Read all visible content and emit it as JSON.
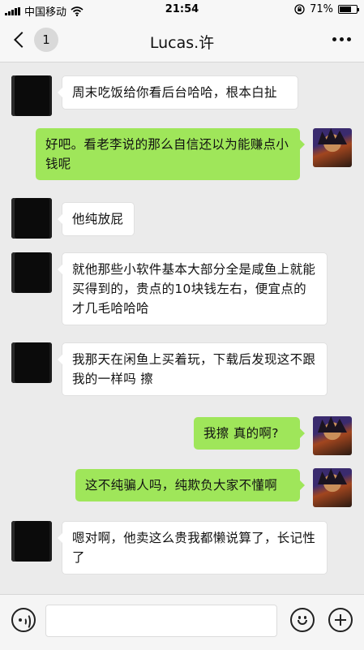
{
  "status_bar": {
    "carrier": "中国移动",
    "time": "21:54",
    "battery": "71%",
    "battery_level": 0.71,
    "icons": [
      "signal-icon",
      "wifi-icon",
      "orientation-lock-icon",
      "battery-icon"
    ]
  },
  "nav": {
    "unread_count": "1",
    "title": "Lucas.许",
    "icons": [
      "back-chevron-icon",
      "more-icon"
    ]
  },
  "messages": [
    {
      "side": "in",
      "text": "周末吃饭给你看后台哈哈，根本白扯"
    },
    {
      "side": "out",
      "text": "好吧。看老李说的那么自信还以为能赚点小钱呢"
    },
    {
      "side": "in",
      "text": "他纯放屁"
    },
    {
      "side": "in",
      "text": "就他那些小软件基本大部分全是咸鱼上就能买得到的，贵点的10块钱左右，便宜点的才几毛哈哈哈"
    },
    {
      "side": "in",
      "text": "我那天在闲鱼上买着玩，下载后发现这不跟我的一样吗 擦"
    },
    {
      "side": "out",
      "text": "我擦 真的啊?"
    },
    {
      "side": "out",
      "text": "这不纯骗人吗，纯欺负大家不懂啊"
    },
    {
      "side": "in",
      "text": "嗯对啊，他卖这么贵我都懒说算了，长记性了"
    }
  ],
  "input_bar": {
    "icons": [
      "voice-icon",
      "emoji-icon",
      "plus-icon"
    ]
  },
  "colors": {
    "background": "#ebebeb",
    "outgoing_bubble": "#9fe65a",
    "incoming_bubble": "#ffffff"
  }
}
